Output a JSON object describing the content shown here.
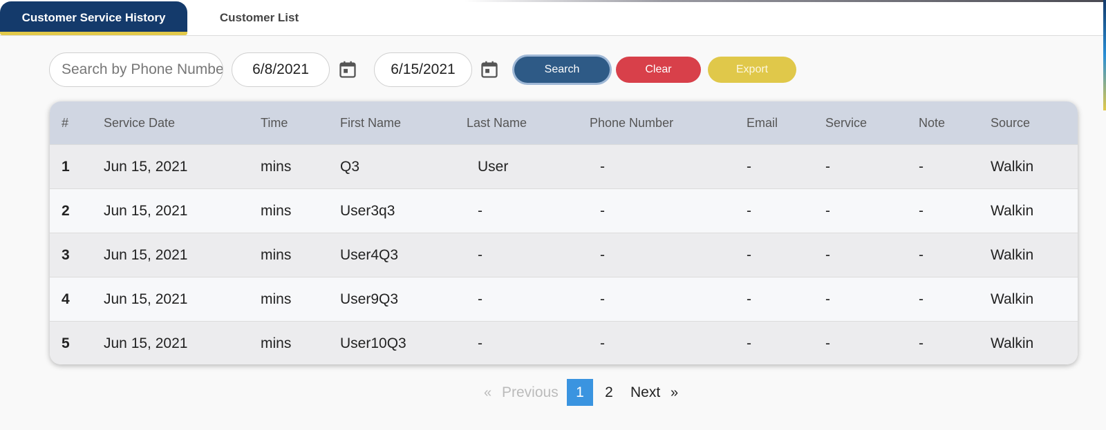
{
  "tabs": {
    "active": "Customer Service History",
    "inactive": "Customer List"
  },
  "filters": {
    "search_placeholder": "Search by Phone Number",
    "search_value": "",
    "start_date": "6/8/2021",
    "end_date": "6/15/2021"
  },
  "buttons": {
    "search": "Search",
    "clear": "Clear",
    "export": "Export"
  },
  "icons": {
    "calendar": "calendar-icon"
  },
  "colors": {
    "brand_navy": "#143a6b",
    "accent_yellow": "#e2c94a",
    "search_button": "#2e5a86",
    "clear_button": "#d8404a",
    "export_button": "#e0c84a",
    "active_page": "#3a94e0"
  },
  "table": {
    "columns": [
      "#",
      "Service Date",
      "Time",
      "First Name",
      "Last Name",
      "Phone Number",
      "Email",
      "Service",
      "Note",
      "Source"
    ],
    "rows": [
      [
        "1",
        "Jun 15, 2021",
        "mins",
        "Q3",
        "User",
        "-",
        "-",
        "-",
        "-",
        "Walkin"
      ],
      [
        "2",
        "Jun 15, 2021",
        "mins",
        "User3q3",
        "-",
        "-",
        "-",
        "-",
        "-",
        "Walkin"
      ],
      [
        "3",
        "Jun 15, 2021",
        "mins",
        "User4Q3",
        "-",
        "-",
        "-",
        "-",
        "-",
        "Walkin"
      ],
      [
        "4",
        "Jun 15, 2021",
        "mins",
        "User9Q3",
        "-",
        "-",
        "-",
        "-",
        "-",
        "Walkin"
      ],
      [
        "5",
        "Jun 15, 2021",
        "mins",
        "User10Q3",
        "-",
        "-",
        "-",
        "-",
        "-",
        "Walkin"
      ]
    ]
  },
  "pagination": {
    "prev_arrow": "«",
    "prev_label": "Previous",
    "pages": [
      "1",
      "2"
    ],
    "current_page": "1",
    "next_label": "Next",
    "next_arrow": "»"
  }
}
